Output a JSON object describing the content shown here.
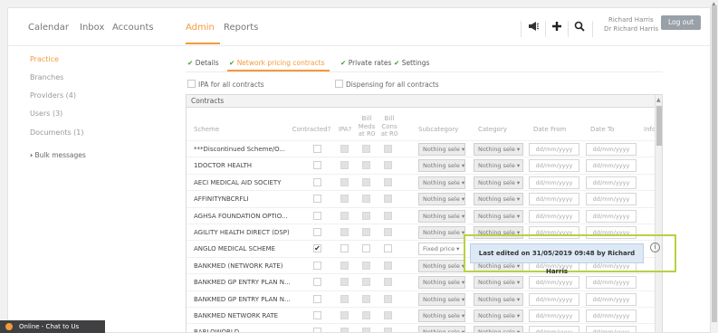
{
  "topnav": {
    "items": [
      "Calendar",
      "Inbox",
      "Accounts",
      "Admin",
      "Reports"
    ],
    "active": "Admin",
    "icons": [
      "megaphone-icon",
      "plus-icon",
      "search-icon"
    ],
    "user_name": "Richard Harris",
    "user_title": "Dr Richard Harris",
    "logout_label": "Log out"
  },
  "sidebar": {
    "items": [
      "Practice",
      "Branches",
      "Providers (4)",
      "Users (3)",
      "Documents (1)"
    ],
    "active": "Practice",
    "bulk_messages": "Bulk messages"
  },
  "subtabs": [
    "Details",
    "Network pricing contracts",
    "Private rates",
    "Settings"
  ],
  "active_subtab": "Network pricing contracts",
  "options": {
    "ipa_all": "IPA for all contracts",
    "dispensing_all": "Dispensing for all contracts"
  },
  "table": {
    "title": "Contracts",
    "headers": {
      "scheme": "Scheme",
      "contracted": "Contracted?",
      "ipa": "IPA?",
      "bill_meds": "Bill\nMeds\nat R0",
      "bill_cons": "Bill\nCons\nat R0",
      "subcategory": "Subcategory",
      "category": "Category",
      "date_from": "Date From",
      "date_to": "Date To",
      "info": "Info"
    },
    "rows": [
      {
        "scheme": "***Discontinued Scheme/O...",
        "contracted": false,
        "subcategory": "Nothing sele",
        "category": "Nothing sele",
        "date_from": "dd/mm/yyyy",
        "date_to": "dd/mm/yyyy"
      },
      {
        "scheme": "1DOCTOR HEALTH",
        "contracted": false,
        "subcategory": "Nothing sele",
        "category": "Nothing sele",
        "date_from": "dd/mm/yyyy",
        "date_to": "dd/mm/yyyy"
      },
      {
        "scheme": "AECI MEDICAL AID SOCIETY",
        "contracted": false,
        "subcategory": "Nothing sele",
        "category": "Nothing sele",
        "date_from": "dd/mm/yyyy",
        "date_to": "dd/mm/yyyy"
      },
      {
        "scheme": "AFFINITYNBCRFLI",
        "contracted": false,
        "subcategory": "Nothing sele",
        "category": "Nothing sele",
        "date_from": "dd/mm/yyyy",
        "date_to": "dd/mm/yyyy"
      },
      {
        "scheme": "AGHSA FOUNDATION OPTIO...",
        "contracted": false,
        "subcategory": "Nothing sele",
        "category": "Nothing sele",
        "date_from": "dd/mm/yyyy",
        "date_to": "dd/mm/yyyy"
      },
      {
        "scheme": "AGILITY HEALTH DIRECT (DSP)",
        "contracted": false,
        "subcategory": "Nothing sele",
        "category": "Nothing sele",
        "date_from": "dd/mm/yyyy",
        "date_to": "dd/mm/yyyy"
      },
      {
        "scheme": "ANGLO MEDICAL SCHEME",
        "contracted": true,
        "subcategory": "Fixed price",
        "category": "",
        "date_from": "",
        "date_to": ""
      },
      {
        "scheme": "BANKMED (NETWORK RATE)",
        "contracted": false,
        "subcategory": "Nothing sele",
        "category": "Nothing sele",
        "date_from": "dd/mm/yyyy",
        "date_to": "dd/mm/yyyy"
      },
      {
        "scheme": "BANKMED GP ENTRY PLAN N...",
        "contracted": false,
        "subcategory": "Nothing sele",
        "category": "Nothing sele",
        "date_from": "dd/mm/yyyy",
        "date_to": "dd/mm/yyyy"
      },
      {
        "scheme": "BANKMED GP ENTRY PLAN N...",
        "contracted": false,
        "subcategory": "Nothing sele",
        "category": "Nothing sele",
        "date_from": "dd/mm/yyyy",
        "date_to": "dd/mm/yyyy"
      },
      {
        "scheme": "BANKMED NETWORK RATE",
        "contracted": false,
        "subcategory": "Nothing sele",
        "category": "Nothing sele",
        "date_from": "dd/mm/yyyy",
        "date_to": "dd/mm/yyyy"
      },
      {
        "scheme": "BARLOWORLD",
        "contracted": false,
        "subcategory": "Nothing sele",
        "category": "Nothing sele",
        "date_from": "dd/mm/yyyy",
        "date_to": "dd/mm/yyyy"
      }
    ]
  },
  "tooltip": {
    "text": "Last edited on 31/05/2019 09:48 by Richard Harris"
  },
  "chat": {
    "label": "Online - Chat to Us"
  },
  "colors": {
    "accent": "#f39a3c",
    "check": "#4a9a2a",
    "highlight": "#b5d244"
  }
}
